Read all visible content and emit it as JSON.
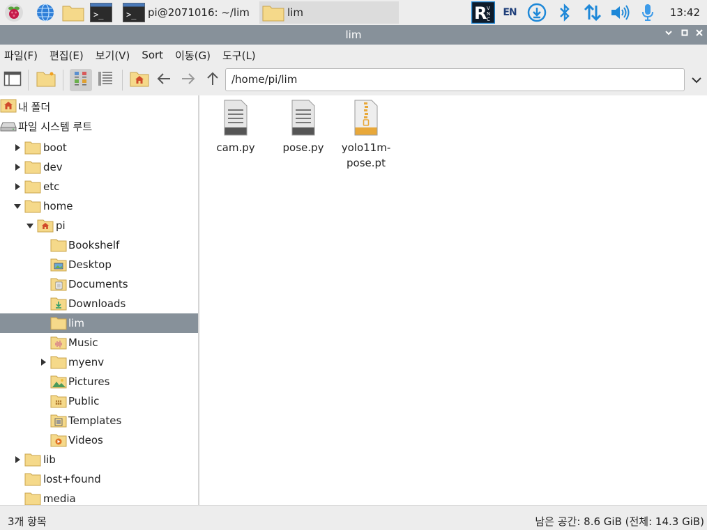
{
  "taskbar": {
    "terminal_task_label": "pi@2071016: ~/lim",
    "files_task_label": "lim",
    "clock": "13:42",
    "language_indicator": "EN",
    "icons": [
      "raspberry-menu-icon",
      "web-browser-icon",
      "file-manager-icon",
      "terminal-icon",
      "vnc-icon",
      "keyboard-layout-icon",
      "updater-icon",
      "bluetooth-icon",
      "network-icon",
      "volume-icon",
      "microphone-icon"
    ],
    "colors": {
      "bluetooth": "#1e7bd6",
      "accent": "#1e88d8"
    }
  },
  "window": {
    "title": "lim",
    "controls": [
      "minimize",
      "maximize",
      "close"
    ]
  },
  "menubar": {
    "items": [
      "파일(F)",
      "편집(E)",
      "보기(V)",
      "Sort",
      "이동(G)",
      "도구(L)"
    ]
  },
  "toolbar": {
    "path": "/home/pi/lim",
    "buttons": [
      "new-window",
      "new-folder",
      "icon-view",
      "list-view",
      "home",
      "back",
      "forward",
      "up"
    ]
  },
  "sidebar": {
    "places": [
      {
        "label": "내 폴더",
        "icon": "home-icon"
      },
      {
        "label": "파일 시스템 루트",
        "icon": "drive-icon"
      }
    ],
    "tree": [
      {
        "label": "boot",
        "expander": "collapsed",
        "icon": "folder",
        "depth": 1
      },
      {
        "label": "dev",
        "expander": "collapsed",
        "icon": "folder",
        "depth": 1
      },
      {
        "label": "etc",
        "expander": "collapsed",
        "icon": "folder",
        "depth": 1
      },
      {
        "label": "home",
        "expander": "expanded",
        "icon": "folder",
        "depth": 1
      },
      {
        "label": "pi",
        "expander": "expanded",
        "icon": "home-folder",
        "depth": 2
      },
      {
        "label": "Bookshelf",
        "expander": "none",
        "icon": "folder",
        "depth": 3
      },
      {
        "label": "Desktop",
        "expander": "none",
        "icon": "desktop-folder",
        "depth": 3
      },
      {
        "label": "Documents",
        "expander": "none",
        "icon": "documents-folder",
        "depth": 3
      },
      {
        "label": "Downloads",
        "expander": "none",
        "icon": "downloads-folder",
        "depth": 3
      },
      {
        "label": "lim",
        "expander": "none",
        "icon": "folder",
        "depth": 3,
        "selected": true
      },
      {
        "label": "Music",
        "expander": "none",
        "icon": "music-folder",
        "depth": 3
      },
      {
        "label": "myenv",
        "expander": "collapsed",
        "icon": "folder",
        "depth": 3
      },
      {
        "label": "Pictures",
        "expander": "none",
        "icon": "pictures-folder",
        "depth": 3
      },
      {
        "label": "Public",
        "expander": "none",
        "icon": "public-folder",
        "depth": 3
      },
      {
        "label": "Templates",
        "expander": "none",
        "icon": "templates-folder",
        "depth": 3
      },
      {
        "label": "Videos",
        "expander": "none",
        "icon": "videos-folder",
        "depth": 3
      },
      {
        "label": "lib",
        "expander": "collapsed",
        "icon": "folder",
        "depth": 1
      },
      {
        "label": "lost+found",
        "expander": "none",
        "icon": "folder",
        "depth": 1
      },
      {
        "label": "media",
        "expander": "none",
        "icon": "folder",
        "depth": 1
      }
    ]
  },
  "files": [
    {
      "name": "cam.py",
      "icon": "text-file-icon"
    },
    {
      "name": "pose.py",
      "icon": "text-file-icon"
    },
    {
      "name": "yolo11m-pose.pt",
      "name_lines": [
        "yolo11m-",
        "pose.pt"
      ],
      "icon": "archive-file-icon"
    }
  ],
  "status": {
    "item_count": "3개 항목",
    "free_space": "남은 공간: 8.6 GiB (전체: 14.3 GiB)"
  },
  "colors": {
    "selection": "#87919a",
    "titlebar": "#87919a",
    "folder": "#f5d98a",
    "folder_edge": "#c9a44c"
  }
}
